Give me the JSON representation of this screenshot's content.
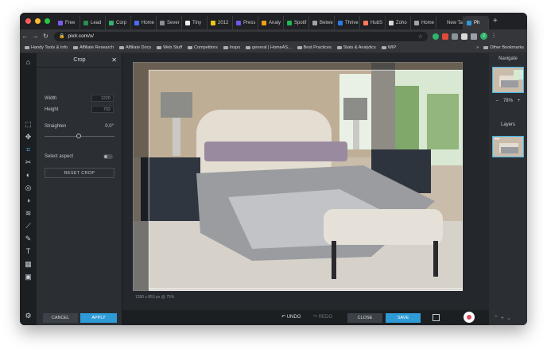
{
  "browser": {
    "tabs": [
      {
        "label": "Free",
        "color": "#7b5cf0"
      },
      {
        "label": "Lead",
        "color": "#2b8d4f"
      },
      {
        "label": "Corp",
        "color": "#2fb36d"
      },
      {
        "label": "Home",
        "color": "#4a6cf7"
      },
      {
        "label": "Sever",
        "color": "#8b8f94"
      },
      {
        "label": "Tiny",
        "color": "#eeeeee"
      },
      {
        "label": "2012",
        "color": "#f0c419"
      },
      {
        "label": "Press",
        "color": "#6b5cf0"
      },
      {
        "label": "Analy",
        "color": "#f39c12"
      },
      {
        "label": "Spotif",
        "color": "#1db954"
      },
      {
        "label": "Betwe",
        "color": "#a0a4a8"
      },
      {
        "label": "Thrive",
        "color": "#2c7be5"
      },
      {
        "label": "HubS",
        "color": "#ff7a59"
      },
      {
        "label": "Zoho",
        "color": "#d9d9d9"
      },
      {
        "label": "Home",
        "color": "#a0a4a8"
      },
      {
        "label": "New Tab",
        "color": "#202124"
      },
      {
        "label": "Ph",
        "color": "#2e9bd6"
      }
    ],
    "new_tab_symbol": "+",
    "url": "pixlr.com/x/",
    "bookmarks": [
      "Handy Tools & Info",
      "Affiliate Research",
      "Affiliate Docs",
      "Web Stuff",
      "Competitors",
      "Inspo",
      "general | HomeAS...",
      "Best Practices",
      "Stats & Analytics",
      "WIP"
    ],
    "other_bookmarks": "Other Bookmarks",
    "profile_initial": "J"
  },
  "crop_panel": {
    "title": "Crop",
    "close": "✕",
    "width_label": "Width",
    "width_value": "1220",
    "height_label": "Height",
    "height_value": "702",
    "straighten_label": "Straighten",
    "straighten_value": "0.0°",
    "select_aspect_label": "Select aspect",
    "reset_label": "RESET CROP",
    "cancel_label": "CANCEL",
    "apply_label": "APPLY"
  },
  "canvas": {
    "size_info": "1280 x 853 px @ 75%",
    "undo_label": "UNDO",
    "redo_label": "REDO",
    "close_label": "CLOSE",
    "save_label": "SAVE"
  },
  "right_panel": {
    "navigate_title": "Navigate",
    "zoom_minus": "–",
    "zoom_value": "78%",
    "zoom_plus": "+",
    "layers_title": "Layers",
    "layer_menu": "•••"
  },
  "colors": {
    "accent": "#2e9bd6",
    "traffic_red": "#ff5f57",
    "traffic_yellow": "#febc2e",
    "traffic_green": "#28c840"
  }
}
